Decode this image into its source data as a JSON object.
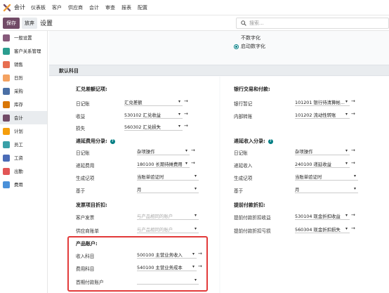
{
  "topbar": {
    "app_name": "会计",
    "menu": [
      "仪表板",
      "客户",
      "供应商",
      "会计",
      "审查",
      "报表",
      "配置"
    ]
  },
  "control": {
    "save_label": "保存",
    "discard_label": "放弃",
    "title": "设置",
    "search_placeholder": "搜索..."
  },
  "sidebar": {
    "items": [
      {
        "label": "一般设置",
        "icon": "gear-icon",
        "color": "#875a7b"
      },
      {
        "label": "客户关系管理",
        "icon": "crm-icon",
        "color": "#2a9d8f"
      },
      {
        "label": "销售",
        "icon": "sales-chart-icon",
        "color": "#e76f51"
      },
      {
        "label": "日历",
        "icon": "calendar-icon",
        "color": "#f4a261"
      },
      {
        "label": "采购",
        "icon": "purchase-icon",
        "color": "#4a6fa5"
      },
      {
        "label": "库存",
        "icon": "inventory-box-icon",
        "color": "#d97706"
      },
      {
        "label": "会计",
        "icon": "accounting-icon",
        "color": "#714b67"
      },
      {
        "label": "计划",
        "icon": "planning-icon",
        "color": "#f59e0b"
      },
      {
        "label": "员工",
        "icon": "employees-icon",
        "color": "#3aa0a8"
      },
      {
        "label": "工资",
        "icon": "payroll-icon",
        "color": "#4b6cb7"
      },
      {
        "label": "出勤",
        "icon": "attendance-icon",
        "color": "#e25555"
      },
      {
        "label": "费用",
        "icon": "expenses-icon",
        "color": "#4a90d9"
      }
    ],
    "active_index": 6
  },
  "main": {
    "radio_top_label": "不数字化",
    "radio_selected_label": "启动数字化",
    "section_title": "默认科目",
    "exchange": {
      "title": "汇兑差额记项:",
      "rows": [
        {
          "label": "日记账",
          "value": "汇兑差额"
        },
        {
          "label": "收益",
          "value": "530102 汇兑收益"
        },
        {
          "label": "损失",
          "value": "560302 汇兑损失"
        }
      ]
    },
    "bank": {
      "title": "银行交易和付款:",
      "rows": [
        {
          "label": "银行暂记",
          "value": "101201 银行待清算帐..."
        },
        {
          "label": "内部转账",
          "value": "101202 流动性转账"
        }
      ]
    },
    "deferred_expense": {
      "title": "递延费用分录:",
      "rows": [
        {
          "label": "日记账",
          "value": "杂项操作"
        },
        {
          "label": "递延费用",
          "value": "180100 长期待摊费用"
        },
        {
          "label": "生成记项",
          "value": "当账单验证时"
        },
        {
          "label": "基于",
          "value": "月"
        }
      ]
    },
    "deferred_revenue": {
      "title": "递延收入分录:",
      "rows": [
        {
          "label": "日记账",
          "value": "杂项操作"
        },
        {
          "label": "递延收入",
          "value": "240100 递延收益"
        },
        {
          "label": "生成记项",
          "value": "当账单验证时"
        },
        {
          "label": "基于",
          "value": "月"
        }
      ]
    },
    "invoice_discount": {
      "title": "发票项目折扣:",
      "rows": [
        {
          "label": "客户发票",
          "value": "与产品相同的账户"
        },
        {
          "label": "供应商账单",
          "value": "与产品相同的账户"
        }
      ]
    },
    "early_payment": {
      "title": "提前付款折扣:",
      "rows": [
        {
          "label": "提前付款折扣收益",
          "value": "530104 现金折扣收益"
        },
        {
          "label": "提前付款折扣亏损",
          "value": "560304 现金折扣损失"
        }
      ]
    },
    "product_accounts": {
      "title": "产品账户:",
      "rows": [
        {
          "label": "收入科目",
          "value": "500100 主营业务收入"
        },
        {
          "label": "费用科目",
          "value": "540100 主营业务成本"
        },
        {
          "label": "首期付款账户",
          "value": ""
        }
      ]
    }
  }
}
